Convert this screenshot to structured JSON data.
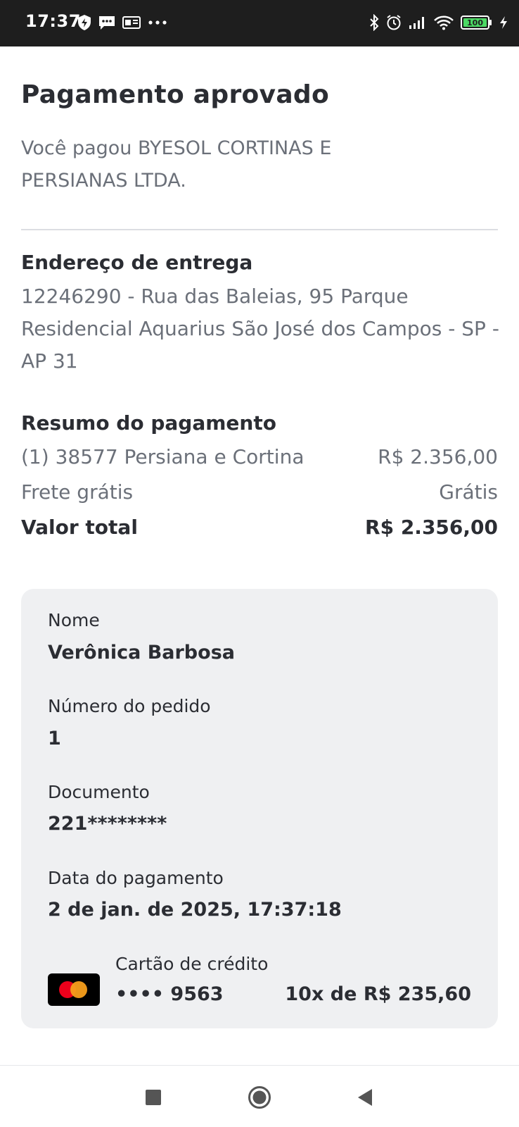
{
  "status_bar": {
    "time": "17:37",
    "battery": "100",
    "icons_left": [
      "shield-icon",
      "chat-icon",
      "sim-icon",
      "more-icon"
    ],
    "icons_right": [
      "bluetooth-icon",
      "alarm-icon",
      "signal-icon",
      "wifi-icon",
      "battery-icon",
      "charging-icon"
    ]
  },
  "page": {
    "title": "Pagamento aprovado",
    "subtitle": "Você pagou BYESOL CORTINAS E PERSIANAS LTDA."
  },
  "address": {
    "title": "Endereço de entrega",
    "text": "12246290 - Rua das Baleias, 95 Parque Residencial Aquarius São José dos Campos - SP - AP 31"
  },
  "summary": {
    "title": "Resumo do pagamento",
    "item_label": "(1) 38577 Persiana e Cortina",
    "item_value": "R$ 2.356,00",
    "shipping_label": "Frete grátis",
    "shipping_value": "Grátis",
    "total_label": "Valor total",
    "total_value": "R$ 2.356,00"
  },
  "details": {
    "name_label": "Nome",
    "name_value": "Verônica Barbosa",
    "order_label": "Número do pedido",
    "order_value": "1",
    "document_label": "Documento",
    "document_value": "221********",
    "date_label": "Data do pagamento",
    "date_value": "2 de jan. de 2025, 17:37:18",
    "card_type": "Cartão de crédito",
    "card_number": "•••• 9563",
    "installments": "10x de R$ 235,60"
  },
  "colors": {
    "text_primary": "#2b2d33",
    "text_secondary": "#6b7079",
    "card_background": "#eff0f2",
    "status_bar": "#1e1e1e",
    "battery_green": "#4cd964"
  },
  "nav": {
    "buttons": [
      "recents-icon",
      "home-icon",
      "back-icon"
    ]
  }
}
